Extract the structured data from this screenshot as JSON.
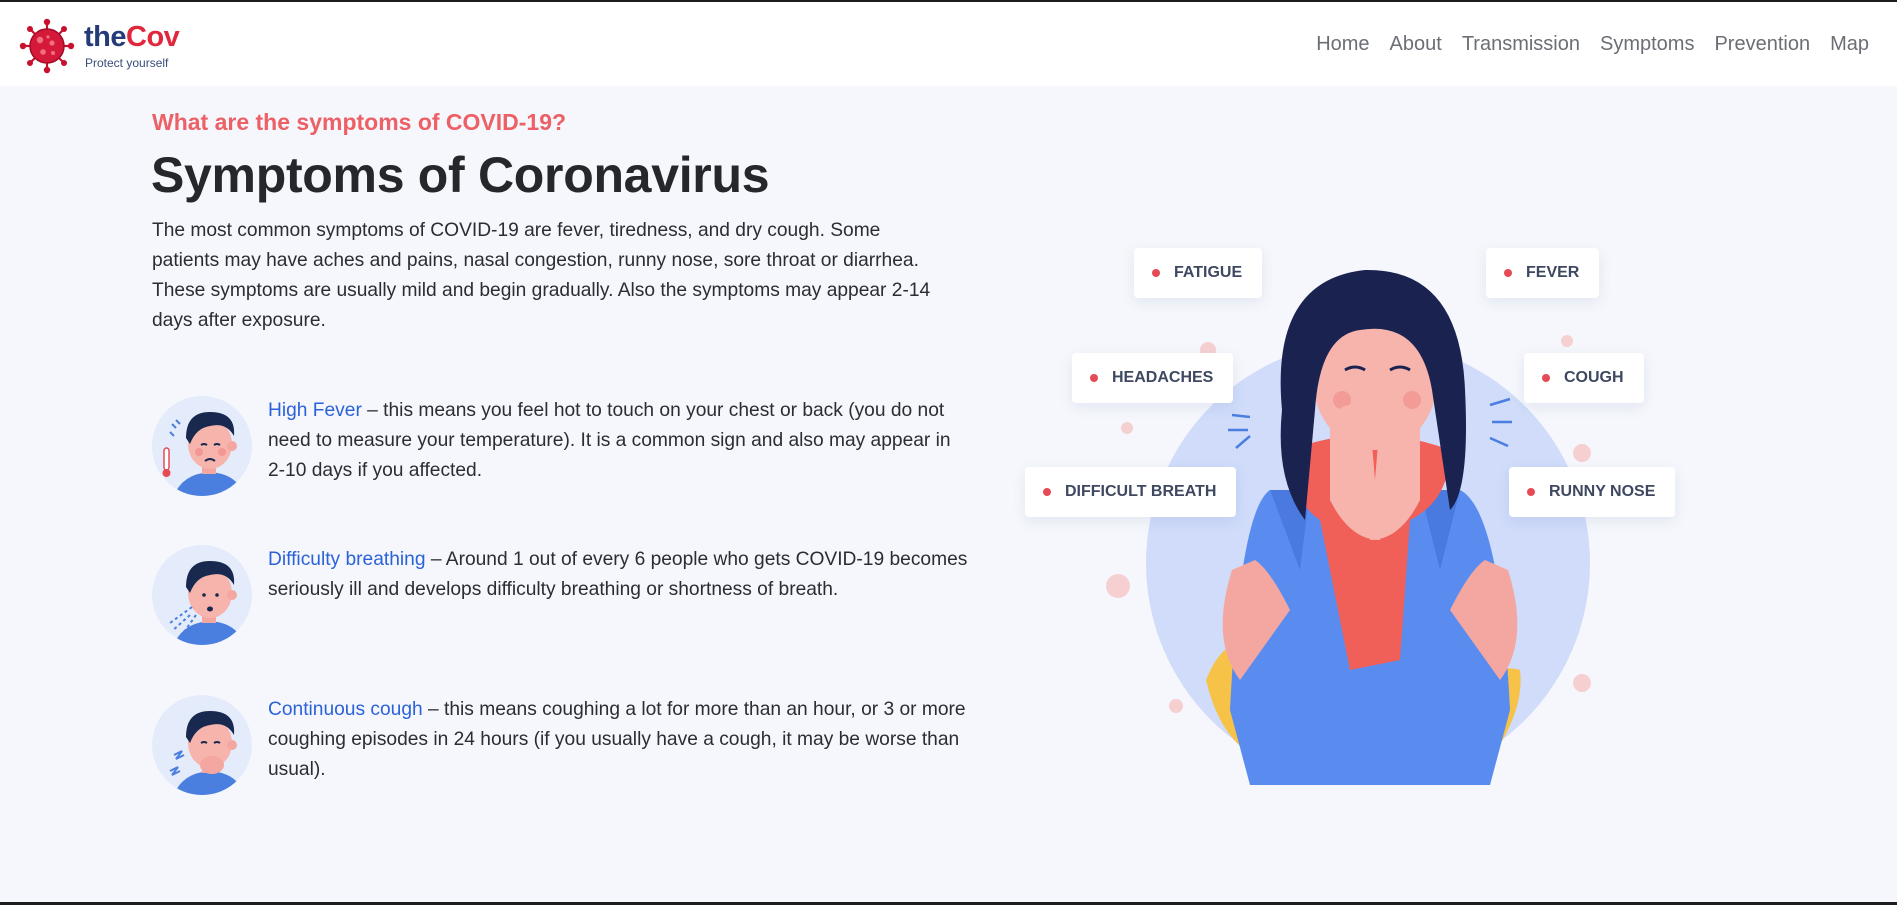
{
  "brand": {
    "name_part1": "the",
    "name_part2": "Cov",
    "tagline": "Protect yourself"
  },
  "nav": {
    "items": [
      "Home",
      "About",
      "Transmission",
      "Symptoms",
      "Prevention",
      "Map"
    ]
  },
  "section": {
    "eyebrow": "What are the symptoms of COVID-19?",
    "title": "Symptoms of Coronavirus",
    "lead": "The most common symptoms of COVID-19 are fever, tiredness, and dry cough. Some patients may have aches and pains, nasal congestion, runny nose, sore throat or diarrhea. These symptoms are usually mild and begin gradually. Also the symptoms may appear 2-14 days after exposure."
  },
  "symptoms": [
    {
      "name": "High Fever",
      "desc": " – this means you feel hot to touch on your chest or back (you do not need to measure your temperature). It is a common sign and also may appear in 2-10 days if you affected."
    },
    {
      "name": "Difficulty breathing",
      "desc": " – Around 1 out of every 6 people who gets COVID-19 becomes seriously ill and develops difficulty breathing or shortness of breath."
    },
    {
      "name": "Continuous cough",
      "desc": " – this means coughing a lot for more than an hour, or 3 or more coughing episodes in 24 hours (if you usually have a cough, it may be worse than usual)."
    }
  ],
  "illustration_tags": {
    "fatigue": "FATIGUE",
    "fever": "FEVER",
    "headaches": "HEADACHES",
    "cough": "COUGH",
    "difficult_breath": "DIFFICULT BREATH",
    "runny_nose": "RUNNY NOSE"
  },
  "colors": {
    "accent_red": "#ec6066",
    "link_blue": "#2b62d9",
    "brand_navy": "#243b78",
    "page_bg": "#f5f7fc"
  }
}
